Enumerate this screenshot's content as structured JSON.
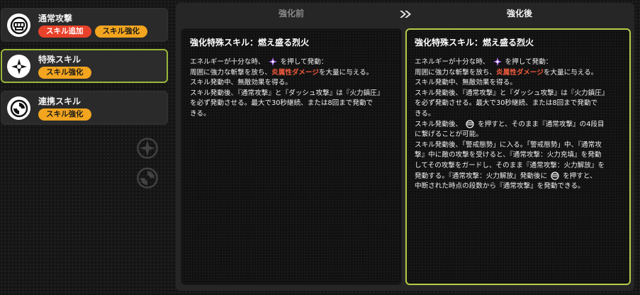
{
  "skills": [
    {
      "name": "通常攻撃",
      "tags": [
        "スキル追加",
        "スキル強化"
      ],
      "icon": "fist-icon"
    },
    {
      "name": "特殊スキル",
      "tags": [
        "スキル強化"
      ],
      "icon": "star-burst-icon",
      "selected": true
    },
    {
      "name": "連携スキル",
      "tags": [
        "スキル強化"
      ],
      "icon": "swirl-icon"
    }
  ],
  "compare": {
    "before_label": "強化前",
    "after_label": "強化後",
    "before": {
      "title": "強化特殊スキル：燃え盛る烈火",
      "l1a": "エネルギーが十分な時、",
      "l1b": "を押して発動：",
      "l2a": "周囲に強力な斬撃を放ち、",
      "l2b": "炎属性ダメージ",
      "l2c": "を大量に与える。",
      "l3": "スキル発動中、無敵効果を得る。",
      "l4": "スキル発動後、『通常攻撃』と『ダッシュ攻撃』は『火力鎮圧』",
      "l5": "を必ず発動させる。最大で30秒継続、または8回まで発動で",
      "l6": "きる。"
    },
    "after": {
      "title": "強化特殊スキル：燃え盛る烈火",
      "l1a": "エネルギーが十分な時、",
      "l1b": "を押して発動：",
      "l2a": "周囲に強力な斬撃を放ち、",
      "l2b": "炎属性ダメージ",
      "l2c": "を大量に与える。",
      "l3": "スキル発動中、無敵効果を得る。",
      "l4": "スキル発動後、『通常攻撃』と『ダッシュ攻撃』は『火力鎮圧』",
      "l5": "を必ず発動させる。最大で30秒継続、または8回まで発動で",
      "l6": "きる。",
      "l7a": "スキル発動後、",
      "l7b": "を押すと、そのまま『通常攻撃』の4段目",
      "l8": "に繋げることが可能。",
      "l9": "スキル発動後、「警戒態勢」に入る。「警戒態勢」中、『通常攻",
      "l10": "撃』中に敵の攻撃を受けると、『通常攻撃：火力充填』を発動",
      "l11": "してその攻撃をガードし、そのまま『通常攻撃：火力解放』を",
      "l12a": "発動する。『通常攻撃：火力解放』発動後に",
      "l12b": "を押すと、",
      "l13": "中断された時点の段数から『通常攻撃』を発動できる。"
    }
  },
  "colors": {
    "accent": "#b7cc46",
    "tag_red": "#e8422b",
    "tag_orange": "#f3a51f",
    "fire_text": "#f05a3c"
  }
}
